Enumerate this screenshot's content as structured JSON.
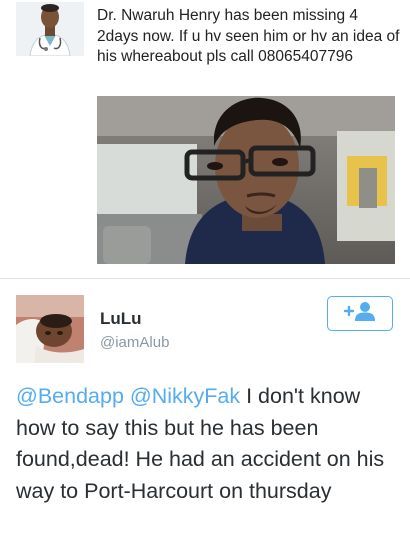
{
  "tweet1": {
    "text": "Dr. Nwaruh Henry has been missing 4 2days now. If u hv seen him or hv an idea of his whereabout pls call 08065407796"
  },
  "tweet2": {
    "user_name": "LuLu",
    "handle": "@iamAlub",
    "follow_icon": "add-user-icon",
    "mention1": "@Bendapp",
    "mention2": "@NikkyFak",
    "body": " I don't know how to say this but he has been found,dead! He had an accident on his way to Port-Harcourt on thursday"
  },
  "colors": {
    "link": "#55acee",
    "handle": "#8899a6",
    "text": "#292f33",
    "divider": "#dfe3e6"
  }
}
